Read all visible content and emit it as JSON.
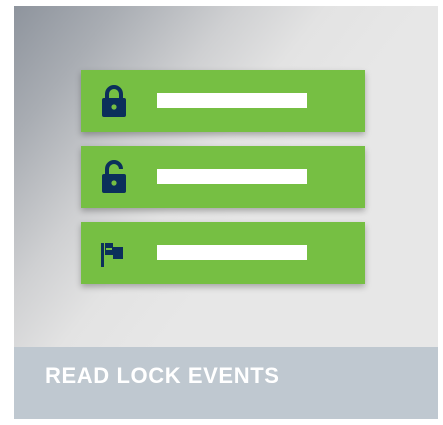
{
  "colors": {
    "row_background": "#76bf43",
    "icon": "#0b2f5b",
    "footer_background": "#bfc8d0",
    "footer_text": "#ffffff"
  },
  "rows": [
    {
      "icon": "lock-closed-icon"
    },
    {
      "icon": "lock-open-icon"
    },
    {
      "icon": "flag-icon"
    }
  ],
  "footer": {
    "title": "READ LOCK EVENTS"
  }
}
